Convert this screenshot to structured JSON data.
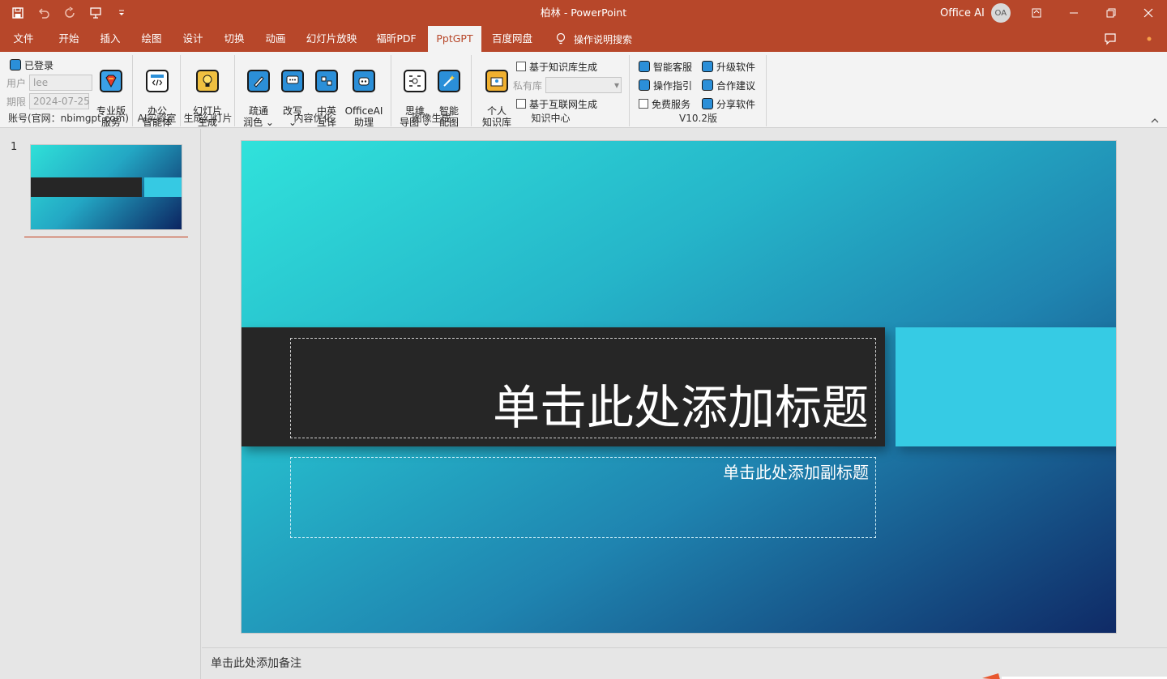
{
  "window": {
    "title": "柏林  -  PowerPoint",
    "account_name": "Office AI",
    "avatar_initials": "OA"
  },
  "menu": {
    "tabs": [
      {
        "label": "文件"
      },
      {
        "label": "开始"
      },
      {
        "label": "插入"
      },
      {
        "label": "绘图"
      },
      {
        "label": "设计"
      },
      {
        "label": "切换"
      },
      {
        "label": "动画"
      },
      {
        "label": "幻灯片放映"
      },
      {
        "label": "福昕PDF"
      },
      {
        "label": "PptGPT",
        "active": true
      },
      {
        "label": "百度网盘"
      }
    ],
    "search_label": "操作说明搜索"
  },
  "ribbon": {
    "account": {
      "status": "已登录",
      "user_label": "用户",
      "user_value": "lee",
      "expiry_label": "期限",
      "expiry_value": "2024-07-25",
      "pro_button": "专业版\n服务",
      "group_label": "账号(官网：nbimgpt.com)"
    },
    "ai_lab": {
      "button": "办公\n智能体",
      "group_label": "AI实验室"
    },
    "generate": {
      "button": "幻灯片\n生成",
      "group_label": "生成幻灯片"
    },
    "content": {
      "polish": "疏通\n润色 ⌄",
      "rewrite": "改写\n⌄",
      "translate": "中英\n互译",
      "assistant": "OfficeAI\n助理",
      "group_label": "内容优化"
    },
    "image": {
      "mindmap": "思维\n导图 ⌄",
      "smartimg": "智能\n配图",
      "group_label": "图像生成"
    },
    "knowledge": {
      "personal": "个人\n知识库",
      "kb_generate": "基于知识库生成",
      "private_label": "私有库",
      "web_generate": "基于互联网生成",
      "group_label": "知识中心"
    },
    "version": {
      "support": "智能客服",
      "guide": "操作指引",
      "free": "免费服务",
      "upgrade": "升级软件",
      "suggest": "合作建议",
      "share": "分享软件",
      "group_label": "V10.2版"
    }
  },
  "slides_panel": {
    "slide_number": "1"
  },
  "slide": {
    "title_placeholder": "单击此处添加标题",
    "subtitle_placeholder": "单击此处添加副标题"
  },
  "notes": {
    "placeholder": "单击此处添加备注"
  },
  "colors": {
    "brand": "#b7472a",
    "ribbon_bg": "#f3f3f3",
    "title_band": "#262626",
    "accent_block": "#36cbe4"
  }
}
